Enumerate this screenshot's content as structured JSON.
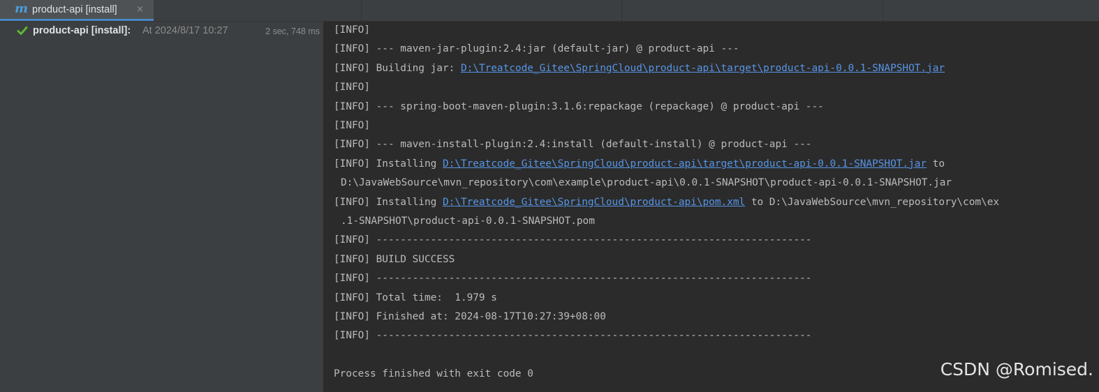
{
  "tab": {
    "icon": "m",
    "label": "product-api [install]",
    "close": "×"
  },
  "tree": {
    "status_icon": "check-icon",
    "title": "product-api [install]:",
    "time": "At 2024/8/17 10:27",
    "duration": "2 sec, 748 ms"
  },
  "console": {
    "lines": [
      {
        "text": "[INFO]"
      },
      {
        "text": "[INFO] --- maven-jar-plugin:2.4:jar (default-jar) @ product-api ---"
      },
      {
        "prefix": "[INFO] Building jar: ",
        "link": "D:\\Treatcode_Gitee\\SpringCloud\\product-api\\target\\product-api-0.0.1-SNAPSHOT.jar",
        "suffix": ""
      },
      {
        "text": "[INFO]"
      },
      {
        "text": "[INFO] --- spring-boot-maven-plugin:3.1.6:repackage (repackage) @ product-api ---"
      },
      {
        "text": "[INFO]"
      },
      {
        "text": "[INFO] --- maven-install-plugin:2.4:install (default-install) @ product-api ---"
      },
      {
        "prefix": "[INFO] Installing ",
        "link": "D:\\Treatcode_Gitee\\SpringCloud\\product-api\\target\\product-api-0.0.1-SNAPSHOT.jar",
        "suffix": " to"
      },
      {
        "text": "D:\\JavaWebSource\\mvn_repository\\com\\example\\product-api\\0.0.1-SNAPSHOT\\product-api-0.0.1-SNAPSHOT.jar",
        "cont": true
      },
      {
        "prefix": "[INFO] Installing ",
        "link": "D:\\Treatcode_Gitee\\SpringCloud\\product-api\\pom.xml",
        "suffix": " to D:\\JavaWebSource\\mvn_repository\\com\\ex"
      },
      {
        "text": ".1-SNAPSHOT\\product-api-0.0.1-SNAPSHOT.pom",
        "cont": true
      },
      {
        "text": "[INFO] ------------------------------------------------------------------------"
      },
      {
        "text": "[INFO] BUILD SUCCESS"
      },
      {
        "text": "[INFO] ------------------------------------------------------------------------"
      },
      {
        "text": "[INFO] Total time:  1.979 s"
      },
      {
        "text": "[INFO] Finished at: 2024-08-17T10:27:39+08:00"
      },
      {
        "text": "[INFO] ------------------------------------------------------------------------"
      },
      {
        "text": ""
      },
      {
        "text": "Process finished with exit code 0"
      }
    ]
  },
  "watermark": "CSDN @Romised.",
  "colors": {
    "accent": "#4a88c7",
    "success": "#5fb832",
    "link": "#5795e6",
    "console_text": "#bbbbbb"
  }
}
